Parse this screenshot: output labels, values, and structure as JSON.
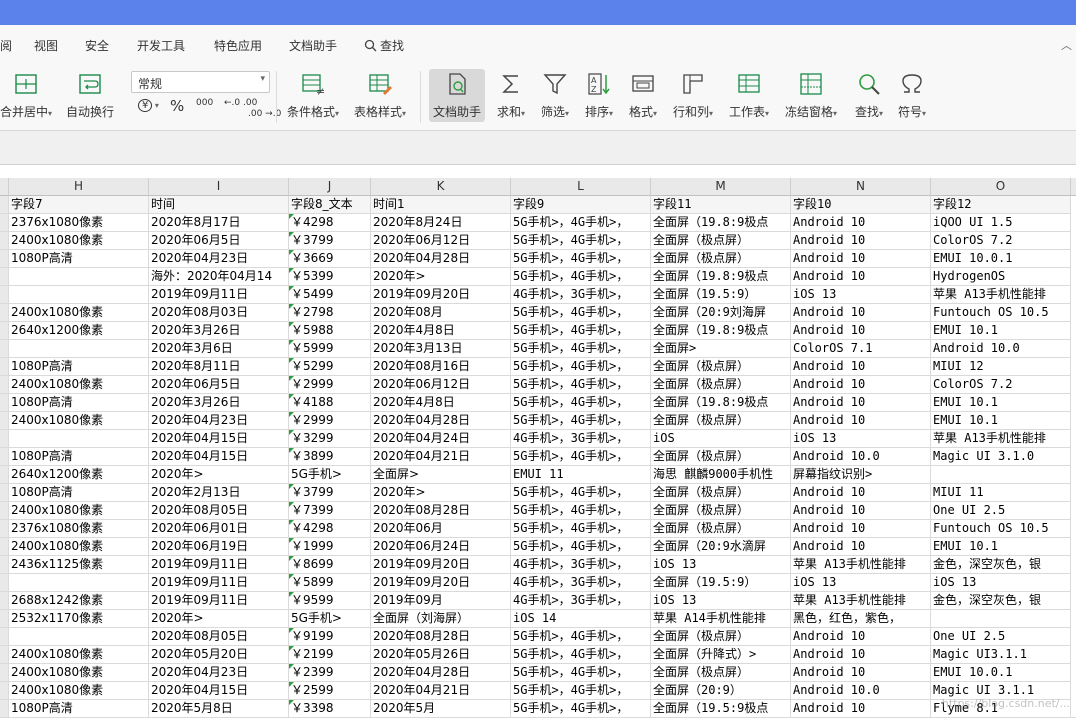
{
  "menu": {
    "items": [
      "阅",
      "视图",
      "安全",
      "开发工具",
      "特色应用",
      "文档助手",
      "查找"
    ]
  },
  "toolbar": {
    "merge_center": "合并居中",
    "auto_wrap": "自动换行",
    "number_format": "常规",
    "currency_symbol": "¥",
    "percent_symbol": "%",
    "thousands_symbol": "000",
    "increase_decimal": "←.0 .00",
    "decrease_decimal": ".00 →.0",
    "conditional_format": "条件格式",
    "table_style": "表格样式",
    "doc_assistant": "文档助手",
    "sum": "求和",
    "filter": "筛选",
    "sort": "排序",
    "format": "格式",
    "row_col": "行和列",
    "worksheet": "工作表",
    "freeze": "冻结窗格",
    "find": "查找",
    "symbol": "符号"
  },
  "columns": [
    "H",
    "I",
    "J",
    "K",
    "L",
    "M",
    "N",
    "O"
  ],
  "rows": [
    [
      "字段7",
      "时间",
      "字段8_文本",
      "时间1",
      "字段9",
      "字段11",
      "字段10",
      "字段12"
    ],
    [
      "2376x1080像素",
      "2020年8月17日",
      "￥4298",
      "2020年8月24日",
      "5G手机>，4G手机>，",
      "全面屏（19.8:9极点",
      "Android 10",
      "iQOO UI 1.5"
    ],
    [
      "2400x1080像素",
      "2020年06月5日",
      "￥3799",
      "2020年06月12日",
      "5G手机>，4G手机>，",
      "全面屏（极点屏）",
      "Android 10",
      "ColorOS 7.2"
    ],
    [
      "1080P高清",
      "2020年04月23日",
      "￥3669",
      "2020年04月28日",
      "5G手机>，4G手机>，",
      "全面屏（极点屏）",
      "Android 10",
      "EMUI 10.0.1"
    ],
    [
      "",
      "海外：2020年04月14",
      "￥5399",
      "2020年>",
      "5G手机>，4G手机>，",
      "全面屏（19.8:9极点",
      "Android 10",
      "HydrogenOS"
    ],
    [
      "",
      "2019年09月11日",
      "￥5499",
      "2019年09月20日",
      "4G手机>，3G手机>，",
      "全面屏（19.5:9）",
      "iOS 13",
      "苹果 A13手机性能排"
    ],
    [
      "2400x1080像素",
      "2020年08月03日",
      "￥2798",
      "2020年08月",
      "5G手机>，4G手机>，",
      "全面屏（20:9刘海屏",
      "Android 10",
      "Funtouch OS 10.5"
    ],
    [
      "2640x1200像素",
      "2020年3月26日",
      "￥5988",
      "2020年4月8日",
      "5G手机>，4G手机>，",
      "全面屏（19.8:9极点",
      "Android 10",
      "EMUI 10.1"
    ],
    [
      "",
      "2020年3月6日",
      "￥5999",
      "2020年3月13日",
      "5G手机>，4G手机>，",
      "全面屏>",
      "ColorOS 7.1",
      "Android 10.0"
    ],
    [
      "1080P高清",
      "2020年8月11日",
      "￥5299",
      "2020年08月16日",
      "5G手机>，4G手机>，",
      "全面屏（极点屏）",
      "Android 10",
      "MIUI 12"
    ],
    [
      "2400x1080像素",
      "2020年06月5日",
      "￥2999",
      "2020年06月12日",
      "5G手机>，4G手机>，",
      "全面屏（极点屏）",
      "Android 10",
      "ColorOS 7.2"
    ],
    [
      "1080P高清",
      "2020年3月26日",
      "￥4188",
      "2020年4月8日",
      "5G手机>，4G手机>，",
      "全面屏（19.8:9极点",
      "Android 10",
      "EMUI 10.1"
    ],
    [
      "2400x1080像素",
      "2020年04月23日",
      "￥2999",
      "2020年04月28日",
      "5G手机>，4G手机>，",
      "全面屏（极点屏）",
      "Android 10",
      "EMUI 10.1"
    ],
    [
      "",
      "2020年04月15日",
      "￥3299",
      "2020年04月24日",
      "4G手机>，3G手机>，",
      "iOS",
      "iOS 13",
      "苹果 A13手机性能排"
    ],
    [
      "1080P高清",
      "2020年04月15日",
      "￥3899",
      "2020年04月21日",
      "5G手机>，4G手机>，",
      "全面屏（极点屏）",
      "Android 10.0",
      "Magic UI 3.1.0"
    ],
    [
      "2640x1200像素",
      "2020年>",
      "5G手机>",
      "全面屏>",
      "EMUI 11",
      "海思 麒麟9000手机性",
      "屏幕指纹识别>",
      ""
    ],
    [
      "1080P高清",
      "2020年2月13日",
      "￥3799",
      "2020年>",
      "5G手机>，4G手机>，",
      "全面屏（极点屏）",
      "Android 10",
      "MIUI 11"
    ],
    [
      "2400x1080像素",
      "2020年08月05日",
      "￥7399",
      "2020年08月28日",
      "5G手机>，4G手机>，",
      "全面屏（极点屏）",
      "Android 10",
      "One UI 2.5"
    ],
    [
      "2376x1080像素",
      "2020年06月01日",
      "￥4298",
      "2020年06月",
      "5G手机>，4G手机>，",
      "全面屏（极点屏）",
      "Android 10",
      "Funtouch OS 10.5"
    ],
    [
      "2400x1080像素",
      "2020年06月19日",
      "￥1999",
      "2020年06月24日",
      "5G手机>，4G手机>，",
      "全面屏（20:9水滴屏",
      "Android 10",
      "EMUI 10.1"
    ],
    [
      "2436x1125像素",
      "2019年09月11日",
      "￥8699",
      "2019年09月20日",
      "4G手机>，3G手机>，",
      "iOS 13",
      "苹果 A13手机性能排",
      "金色，深空灰色，银"
    ],
    [
      "",
      "2019年09月11日",
      "￥5899",
      "2019年09月20日",
      "4G手机>，3G手机>，",
      "全面屏（19.5:9）",
      "iOS 13",
      "iOS 13"
    ],
    [
      "2688x1242像素",
      "2019年09月11日",
      "￥9599",
      "2019年09月",
      "4G手机>，3G手机>，",
      "iOS 13",
      "苹果 A13手机性能排",
      "金色，深空灰色，银"
    ],
    [
      "2532x1170像素",
      "2020年>",
      "5G手机>",
      "全面屏（刘海屏）",
      "iOS 14",
      "苹果 A14手机性能排",
      "黑色，红色，紫色，",
      ""
    ],
    [
      "",
      "2020年08月05日",
      "￥9199",
      "2020年08月28日",
      "5G手机>，4G手机>，",
      "全面屏（极点屏）",
      "Android 10",
      "One UI 2.5"
    ],
    [
      "2400x1080像素",
      "2020年05月20日",
      "￥2199",
      "2020年05月26日",
      "5G手机>，4G手机>，",
      "全面屏（升降式）>",
      "Android 10",
      "Magic UI3.1.1"
    ],
    [
      "2400x1080像素",
      "2020年04月23日",
      "￥2399",
      "2020年04月28日",
      "5G手机>，4G手机>，",
      "全面屏（极点屏）",
      "Android 10",
      "EMUI 10.0.1"
    ],
    [
      "2400x1080像素",
      "2020年04月15日",
      "￥2599",
      "2020年04月21日",
      "5G手机>，4G手机>，",
      "全面屏（20:9）",
      "Android 10.0",
      "Magic UI 3.1.1"
    ],
    [
      "1080P高清",
      "2020年5月8日",
      "￥3398",
      "2020年5月",
      "5G手机>，4G手机>，",
      "全面屏（19.5:9极点",
      "Android 10",
      "Flyme 8.1"
    ]
  ],
  "watermark": "https://blog.csdn.net/..."
}
